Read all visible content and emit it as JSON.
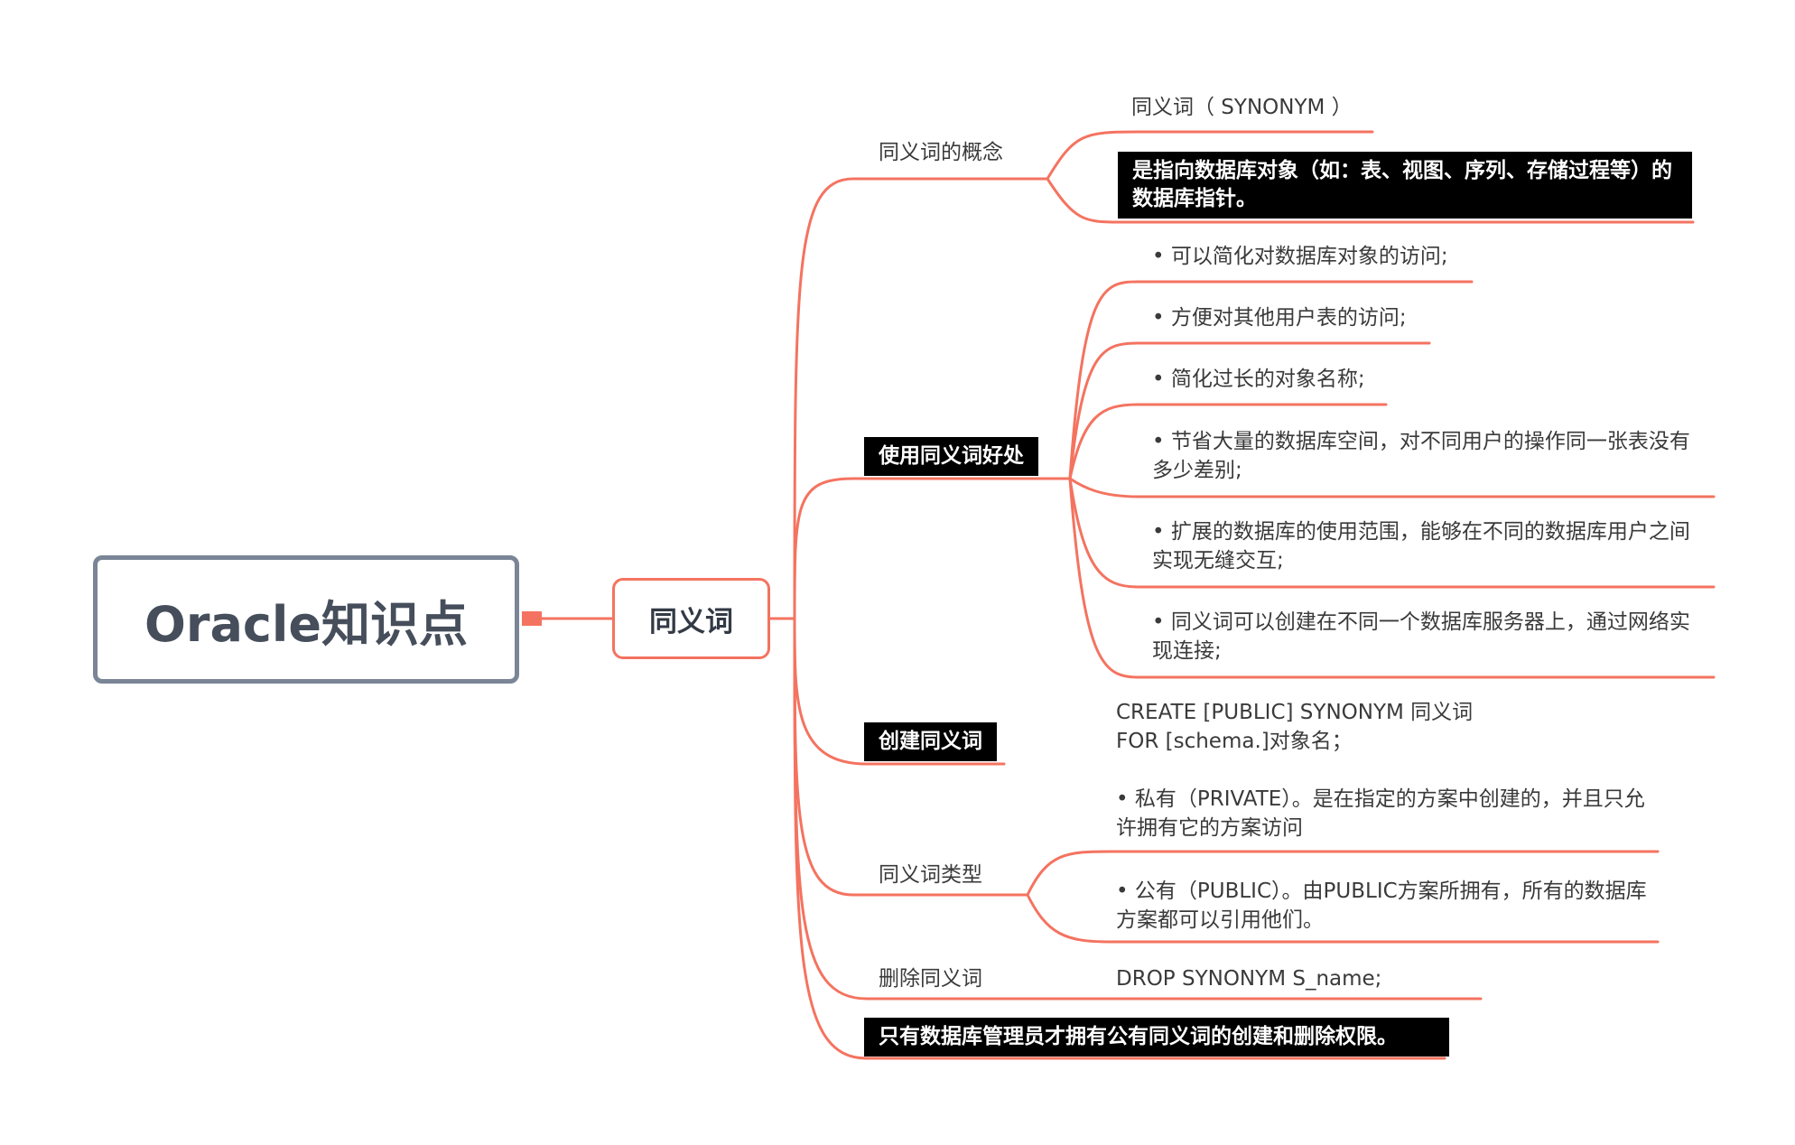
{
  "colors": {
    "branch": "#f47360",
    "root_border": "#7a8596",
    "dark_box": "#000000"
  },
  "root": {
    "title": "Oracle知识点"
  },
  "hub": {
    "title": "同义词"
  },
  "branches": {
    "concept": {
      "label": "同义词的概念",
      "child1": "同义词（ SYNONYM ）",
      "child2": "是指向数据库对象（如：表、视图、序列、存储过程等）的数据库指针。"
    },
    "benefits": {
      "label": "使用同义词好处",
      "items": [
        "• 可以简化对数据库对象的访问;",
        "• 方便对其他用户表的访问;",
        "• 简化过长的对象名称;",
        "• 节省大量的数据库空间，对不同用户的操作同一张表没有多少差别;",
        "• 扩展的数据库的使用范围，能够在不同的数据库用户之间实现无缝交互;",
        "• 同义词可以创建在不同一个数据库服务器上，通过网络实现连接;"
      ]
    },
    "create": {
      "label": "创建同义词",
      "syntax_line1": "CREATE [PUBLIC] SYNONYM 同义词",
      "syntax_line2": "FOR [schema.]对象名；"
    },
    "types": {
      "label": "同义词类型",
      "private": "• 私有（PRIVATE）。是在指定的方案中创建的，并且只允许拥有它的方案访问",
      "public": "• 公有（PUBLIC）。由PUBLIC方案所拥有，所有的数据库方案都可以引用他们。"
    },
    "drop": {
      "label": "删除同义词",
      "syntax": "DROP SYNONYM S_name;"
    },
    "note": {
      "label": "只有数据库管理员才拥有公有同义词的创建和删除权限。"
    }
  }
}
